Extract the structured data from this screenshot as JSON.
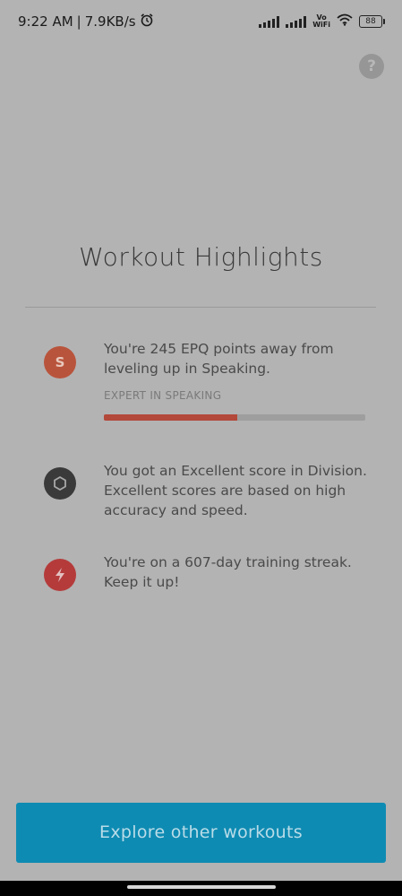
{
  "status_bar": {
    "time": "9:22 AM",
    "speed": "7.9KB/s",
    "separator": "|",
    "alarm_icon": "alarm-clock-icon",
    "vowifi_label_top": "Vo",
    "vowifi_label_bottom": "WiFi",
    "battery": "88"
  },
  "help": {
    "label": "?"
  },
  "header": {
    "title": "Workout Highlights"
  },
  "highlights": [
    {
      "icon": "speaking-icon",
      "icon_text": "S",
      "color": "#b9543c",
      "text": "You're 245 EPQ points away from leveling up in Speaking.",
      "progress_label": "EXPERT IN SPEAKING",
      "progress_fraction": 0.51
    },
    {
      "icon": "hexagon-icon",
      "color": "#3a3a3a",
      "text": "You got an Excellent score in Division. Excellent scores are based on high accuracy and speed."
    },
    {
      "icon": "lightning-icon",
      "color": "#b53b3b",
      "text": "You're on a 607-day training streak. Keep it up!"
    }
  ],
  "cta": {
    "label": "Explore other workouts",
    "color": "#0e8bb3"
  }
}
